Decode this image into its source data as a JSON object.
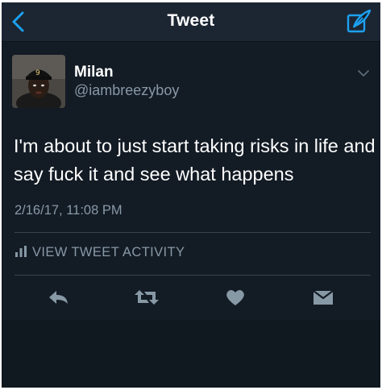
{
  "nav": {
    "title": "Tweet",
    "back_icon": "chevron-left-icon",
    "compose_icon": "compose-feather-icon",
    "accent_color": "#1da1f2"
  },
  "tweet": {
    "author_name": "Milan",
    "author_handle": "@iambreezyboy",
    "text": "I'm about to just start taking risks in life and say fuck it and see what happens",
    "timestamp": "2/16/17, 11:08 PM",
    "activity_label": "VIEW TWEET ACTIVITY",
    "menu_icon": "chevron-down-icon",
    "avatar_cap_text": "9"
  },
  "actions": [
    {
      "icon": "reply-icon"
    },
    {
      "icon": "retweet-icon"
    },
    {
      "icon": "heart-icon"
    },
    {
      "icon": "direct-message-icon"
    }
  ],
  "colors": {
    "background": "#131b25",
    "navbar": "#1c2633",
    "text": "#ffffff",
    "secondary_text": "#8899a6",
    "divider": "#38444d"
  }
}
